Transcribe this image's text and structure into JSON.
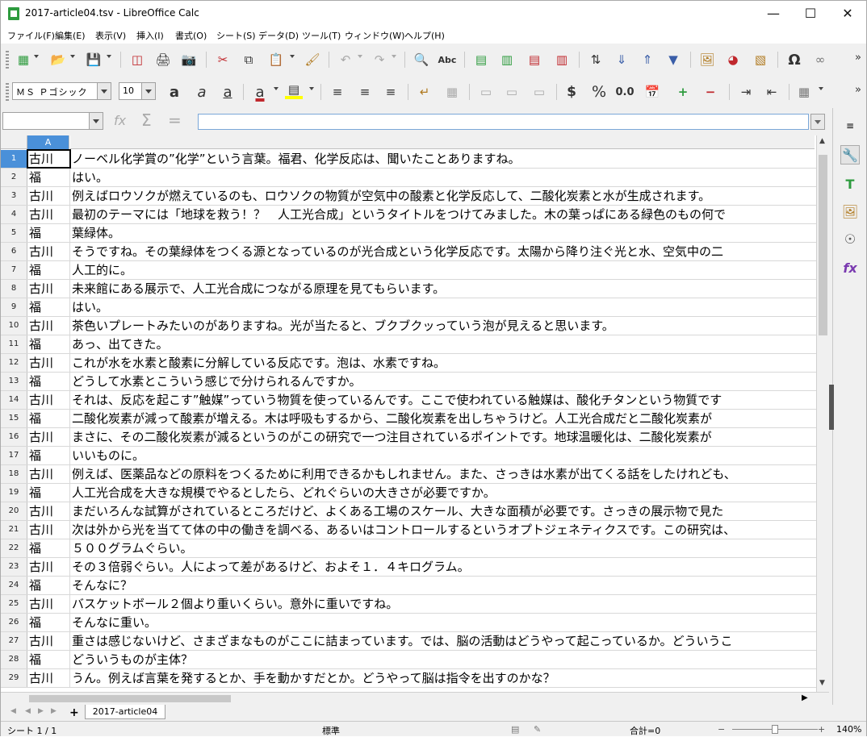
{
  "window": {
    "title": "2017-article04.tsv - LibreOffice Calc"
  },
  "menu": [
    "ファイル(F)",
    "編集(E)",
    "表示(V)",
    "挿入(I)",
    "書式(O)",
    "シート(S)",
    "データ(D)",
    "ツール(T)",
    "ウィンドウ(W)",
    "ヘルプ(H)"
  ],
  "format": {
    "font_name": "ＭＳ Ｐゴシック",
    "font_size": "10",
    "currency": "$",
    "percent": "%",
    "decimal": "0.0"
  },
  "sheet": {
    "column_header": "A",
    "rows": [
      {
        "n": "1",
        "a": "古川",
        "b": "ノーベル化学賞の”化学”という言葉。福君、化学反応は、聞いたことありますね。"
      },
      {
        "n": "2",
        "a": "福",
        "b": "はい。"
      },
      {
        "n": "3",
        "a": "古川",
        "b": "例えばロウソクが燃えているのも、ロウソクの物質が空気中の酸素と化学反応して、二酸化炭素と水が生成されます。"
      },
      {
        "n": "4",
        "a": "古川",
        "b": "最初のテーマには「地球を救う！？　人工光合成」というタイトルをつけてみました。木の葉っぱにある緑色のもの何で"
      },
      {
        "n": "5",
        "a": "福",
        "b": "葉緑体。"
      },
      {
        "n": "6",
        "a": "古川",
        "b": "そうですね。その葉緑体をつくる源となっているのが光合成という化学反応です。太陽から降り注ぐ光と水、空気中の二"
      },
      {
        "n": "7",
        "a": "福",
        "b": "人工的に。"
      },
      {
        "n": "8",
        "a": "古川",
        "b": "未来館にある展示で、人工光合成につながる原理を見てもらいます。"
      },
      {
        "n": "9",
        "a": "福",
        "b": "はい。"
      },
      {
        "n": "10",
        "a": "古川",
        "b": "茶色いプレートみたいのがありますね。光が当たると、ブクブクッっていう泡が見えると思います。"
      },
      {
        "n": "11",
        "a": "福",
        "b": "あっ、出てきた。"
      },
      {
        "n": "12",
        "a": "古川",
        "b": "これが水を水素と酸素に分解している反応です。泡は、水素ですね。"
      },
      {
        "n": "13",
        "a": "福",
        "b": "どうして水素とこういう感じで分けられるんですか。"
      },
      {
        "n": "14",
        "a": "古川",
        "b": "それは、反応を起こす”触媒”っていう物質を使っているんです。ここで使われている触媒は、酸化チタンという物質です"
      },
      {
        "n": "15",
        "a": "福",
        "b": "二酸化炭素が減って酸素が増える。木は呼吸もするから、二酸化炭素を出しちゃうけど。人工光合成だと二酸化炭素が"
      },
      {
        "n": "16",
        "a": "古川",
        "b": "まさに、その二酸化炭素が減るというのがこの研究で一つ注目されているポイントです。地球温暖化は、二酸化炭素が"
      },
      {
        "n": "17",
        "a": "福",
        "b": "いいものに。"
      },
      {
        "n": "18",
        "a": "古川",
        "b": "例えば、医薬品などの原料をつくるために利用できるかもしれません。また、さっきは水素が出てくる話をしたけれども、"
      },
      {
        "n": "19",
        "a": "福",
        "b": "人工光合成を大きな規模でやるとしたら、どれぐらいの大きさが必要ですか。"
      },
      {
        "n": "20",
        "a": "古川",
        "b": "まだいろんな試算がされているところだけど、よくある工場のスケール、大きな面積が必要です。さっきの展示物で見た"
      },
      {
        "n": "21",
        "a": "古川",
        "b": "次は外から光を当てて体の中の働きを調べる、あるいはコントロールするというオプトジェネティクスです。この研究は、"
      },
      {
        "n": "22",
        "a": "福",
        "b": "５００グラムぐらい。"
      },
      {
        "n": "23",
        "a": "古川",
        "b": "その３倍弱ぐらい。人によって差があるけど、およそ１．４キログラム。"
      },
      {
        "n": "24",
        "a": "福",
        "b": "そんなに？"
      },
      {
        "n": "25",
        "a": "古川",
        "b": "バスケットボール２個より重いくらい。意外に重いですね。"
      },
      {
        "n": "26",
        "a": "福",
        "b": "そんなに重い。"
      },
      {
        "n": "27",
        "a": "古川",
        "b": "重さは感じないけど、さまざまなものがここに詰まっています。では、脳の活動はどうやって起こっているか。どういうこ"
      },
      {
        "n": "28",
        "a": "福",
        "b": "どういうものが主体？"
      },
      {
        "n": "29",
        "a": "古川",
        "b": "うん。例えば言葉を発するとか、手を動かすだとか。どうやって脳は指令を出すのかな？"
      }
    ]
  },
  "tabs": {
    "add": "+",
    "sheet_name": "2017-article04"
  },
  "status": {
    "sheet": "シート 1 / 1",
    "style": "標準",
    "sum": "合計=0",
    "zoom": "140%"
  },
  "colors": {
    "selection": "#4a90d9",
    "app_green": "#2e9b3e"
  }
}
